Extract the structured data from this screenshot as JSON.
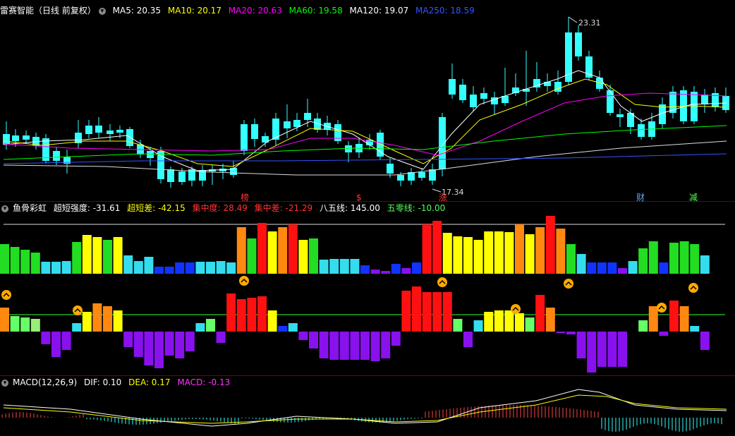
{
  "panel_main": {
    "title": "雷赛智能（日线 前复权）",
    "ma": [
      {
        "label": "MA5: 20.35",
        "color": "#ffffff"
      },
      {
        "label": "MA10: 20.17",
        "color": "#ffff00"
      },
      {
        "label": "MA20: 20.63",
        "color": "#ff00ff"
      },
      {
        "label": "MA60: 19.58",
        "color": "#00ff00"
      },
      {
        "label": "MA120: 19.07",
        "color": "#ffffff"
      },
      {
        "label": "MA250: 18.59",
        "color": "#3355ff"
      }
    ],
    "high_label": "23.31",
    "low_label": "17.34",
    "markers": [
      {
        "text": "榜",
        "color": "#ff3333"
      },
      {
        "text": "$",
        "color": "#ff3333"
      },
      {
        "text": "涨",
        "color": "#ff3333"
      },
      {
        "text": "财",
        "color": "#55aaff"
      },
      {
        "text": "减",
        "color": "#55ff55"
      }
    ]
  },
  "panel_fish": {
    "title": "鱼骨彩虹",
    "items": [
      {
        "label": "超短强度: -31.61",
        "color": "#ffffff"
      },
      {
        "label": "超短差: -42.15",
        "color": "#ffff00"
      },
      {
        "label": "集中度: 28.49",
        "color": "#ff3333"
      },
      {
        "label": "集中差: -21.29",
        "color": "#ff3333"
      },
      {
        "label": "八五线: 145.00",
        "color": "#ffffff"
      },
      {
        "label": "五零线: -10.00",
        "color": "#55ff55"
      }
    ]
  },
  "panel_macd": {
    "title": "MACD(12,26,9)",
    "items": [
      {
        "label": "DIF: 0.10",
        "color": "#ffffff"
      },
      {
        "label": "DEA: 0.17",
        "color": "#ffff00"
      },
      {
        "label": "MACD: -0.13",
        "color": "#ff33ff"
      }
    ]
  },
  "colors": {
    "up": "#ff3333",
    "down": "#33ffff",
    "separator": "#7a0000"
  }
}
